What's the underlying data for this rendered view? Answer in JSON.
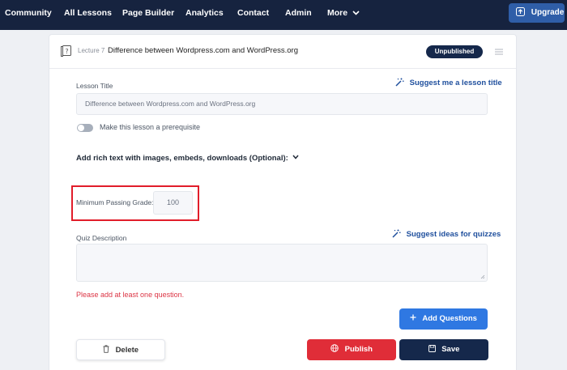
{
  "nav": {
    "items": [
      "Community",
      "All Lessons",
      "Page Builder",
      "Analytics",
      "Contact",
      "Admin",
      "More"
    ],
    "upgrade_label": "Upgrade"
  },
  "lecture": {
    "number_label": "Lecture 7",
    "title": "Difference between Wordpress.com and WordPress.org",
    "status_badge": "Unpublished"
  },
  "form": {
    "lesson_title_label": "Lesson Title",
    "suggest_title_label": "Suggest me a lesson title",
    "lesson_title_value": "Difference between Wordpress.com and WordPress.org",
    "prerequisite_label": "Make this lesson a prerequisite",
    "prerequisite_on": false,
    "rich_text_label": "Add rich text with images, embeds, downloads (Optional):",
    "passing_grade_label": "Minimum Passing Grade:",
    "passing_grade_value": "100",
    "quiz_description_label": "Quiz Description",
    "quiz_description_value": "",
    "suggest_quiz_label": "Suggest ideas for quizzes",
    "error_message": "Please add at least one question."
  },
  "buttons": {
    "add_questions": "Add Questions",
    "delete": "Delete",
    "publish": "Publish",
    "save": "Save"
  },
  "colors": {
    "nav_bg": "#16233f",
    "accent_blue": "#2f78e2",
    "dark_navy": "#15284b",
    "danger_red": "#e02d38",
    "highlight_red": "#e11d2a"
  }
}
